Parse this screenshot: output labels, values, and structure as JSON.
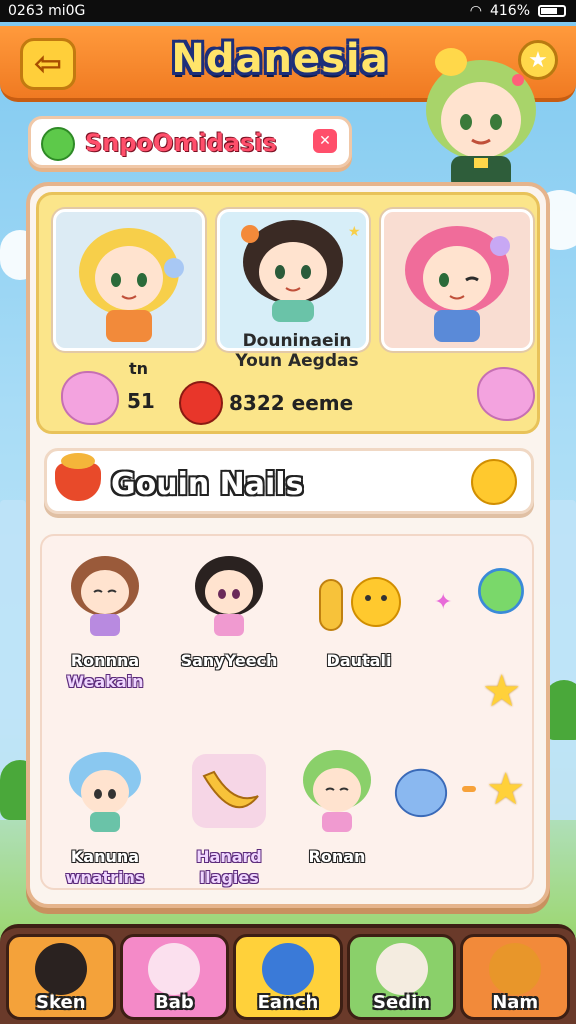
{
  "status_bar": {
    "left": "0263 mi0G",
    "right": "416%"
  },
  "header": {
    "title": "Ndanesia"
  },
  "pill": {
    "label": "SnpoOmidasis"
  },
  "featured": {
    "caption_line1": "Douninaein",
    "caption_line2": "Youn Aegdas",
    "stat1": "tn",
    "stat2": "51",
    "stat3": "8322 eeme"
  },
  "section": {
    "title": "Gouin Nails"
  },
  "grid": {
    "items": [
      {
        "name1": "Ronnna",
        "name2": "Weakain"
      },
      {
        "name1": "SanyYeech",
        "name2": ""
      },
      {
        "name1": "Dautali",
        "name2": ""
      },
      {
        "name1": "Kanuna",
        "name2": "wnatrins"
      },
      {
        "name1": "Hanard",
        "name2": "Ilagies"
      },
      {
        "name1": "Ronan",
        "name2": ""
      }
    ]
  },
  "bottom_nav": {
    "items": [
      {
        "label": "Sken"
      },
      {
        "label": "Bab"
      },
      {
        "label": "Eanch"
      },
      {
        "label": "Sedin"
      },
      {
        "label": "Nam"
      }
    ]
  },
  "colors": {
    "header": "#f07a22",
    "panel": "#fbf4ee",
    "featured_bg": "#fbe58a",
    "nav_bg": "#6a3a2a"
  }
}
